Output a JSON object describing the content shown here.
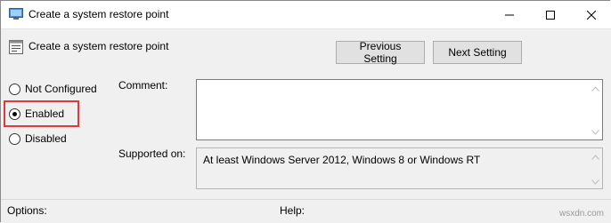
{
  "window": {
    "title": "Create a system restore point",
    "minimize_icon": "minimize-icon",
    "maximize_icon": "maximize-icon",
    "close_icon": "close-icon"
  },
  "header": {
    "setting_name": "Create a system restore point",
    "previous_label": "Previous Setting",
    "next_label": "Next Setting"
  },
  "options": {
    "not_configured": "Not Configured",
    "enabled": "Enabled",
    "disabled": "Disabled",
    "selected": "Enabled"
  },
  "comment": {
    "label": "Comment:",
    "value": ""
  },
  "supported": {
    "label": "Supported on:",
    "value": "At least Windows Server 2012, Windows 8 or Windows RT"
  },
  "footer": {
    "options_label": "Options:",
    "help_label": "Help:"
  },
  "watermark": "wsxdn.com",
  "colors": {
    "highlight": "#e0383b",
    "button_bg": "#e1e1e1"
  }
}
